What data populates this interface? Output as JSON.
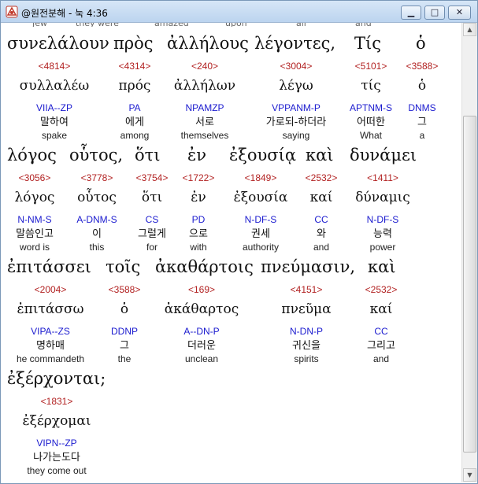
{
  "window": {
    "title": "@원전분해 - 눅 4:36",
    "buttons": {
      "minimize": "▁",
      "maximize": "□",
      "close": "✕"
    }
  },
  "cut_top": [
    "Jew",
    "they were",
    "amazed",
    "upon",
    "all",
    "and"
  ],
  "rows": [
    {
      "greek": [
        "συνελάλουν",
        "πρὸς",
        "ἀλλήλους",
        "λέγοντες,",
        "Τίς",
        "ὁ"
      ],
      "entries": [
        {
          "num": "<4814>",
          "lemma": "συλλαλέω",
          "parse": "VIIA--ZP",
          "kor": "말하여",
          "eng": "spake"
        },
        {
          "num": "<4314>",
          "lemma": "πρός",
          "parse": "PA",
          "kor": "에게",
          "eng": "among"
        },
        {
          "num": "<240>",
          "lemma": "ἀλλήλων",
          "parse": "NPAMZP",
          "kor": "서로",
          "eng": "themselves"
        },
        {
          "num": "<3004>",
          "lemma": "λέγω",
          "parse": "VPPANM-P",
          "kor": "가로되-하더라",
          "eng": "saying"
        },
        {
          "num": "<5101>",
          "lemma": "τίς",
          "parse": "APTNM-S",
          "kor": "어떠한",
          "eng": "What"
        },
        {
          "num": "<3588>",
          "lemma": "ὁ",
          "parse": "DNMS",
          "kor": "그",
          "eng": "a"
        }
      ]
    },
    {
      "greek": [
        "λόγος",
        "οὗτος,",
        "ὅτι",
        "ἐν",
        "ἐξουσίᾳ",
        "καὶ",
        "δυνάμει"
      ],
      "entries": [
        {
          "num": "<3056>",
          "lemma": "λόγος",
          "parse": "N-NM-S",
          "kor": "말씀인고",
          "eng": "word is"
        },
        {
          "num": "<3778>",
          "lemma": "οὗτος",
          "parse": "A-DNM-S",
          "kor": "이",
          "eng": "this"
        },
        {
          "num": "<3754>",
          "lemma": "ὅτι",
          "parse": "CS",
          "kor": "그럴게",
          "eng": "for"
        },
        {
          "num": "<1722>",
          "lemma": "ἐν",
          "parse": "PD",
          "kor": "으로",
          "eng": "with"
        },
        {
          "num": "<1849>",
          "lemma": "ἐξουσία",
          "parse": "N-DF-S",
          "kor": "권세",
          "eng": "authority"
        },
        {
          "num": "<2532>",
          "lemma": "καί",
          "parse": "CC",
          "kor": "와",
          "eng": "and"
        },
        {
          "num": "<1411>",
          "lemma": "δύναμις",
          "parse": "N-DF-S",
          "kor": "능력",
          "eng": "power"
        }
      ]
    },
    {
      "greek": [
        "ἐπιτάσσει",
        "τοῖς",
        "ἀκαθάρτοις",
        "πνεύμασιν,",
        "καὶ"
      ],
      "entries": [
        {
          "num": "<2004>",
          "lemma": "ἐπιτάσσω",
          "parse": "VIPA--ZS",
          "kor": "명하매",
          "eng": "he commandeth"
        },
        {
          "num": "<3588>",
          "lemma": "ὁ",
          "parse": "DDNP",
          "kor": "그",
          "eng": "the"
        },
        {
          "num": "<169>",
          "lemma": "ἀκάθαρτος",
          "parse": "A--DN-P",
          "kor": "더러운",
          "eng": "unclean"
        },
        {
          "num": "<4151>",
          "lemma": "πνεῦμα",
          "parse": "N-DN-P",
          "kor": "귀신을",
          "eng": "spirits"
        },
        {
          "num": "<2532>",
          "lemma": "καί",
          "parse": "CC",
          "kor": "그리고",
          "eng": "and"
        }
      ]
    },
    {
      "greek": [
        "ἐξέρχονται;"
      ],
      "entries": [
        {
          "num": "<1831>",
          "lemma": "ἐξέρχομαι",
          "parse": "VIPN--ZP",
          "kor": "나가는도다",
          "eng": "they come out"
        }
      ]
    }
  ]
}
